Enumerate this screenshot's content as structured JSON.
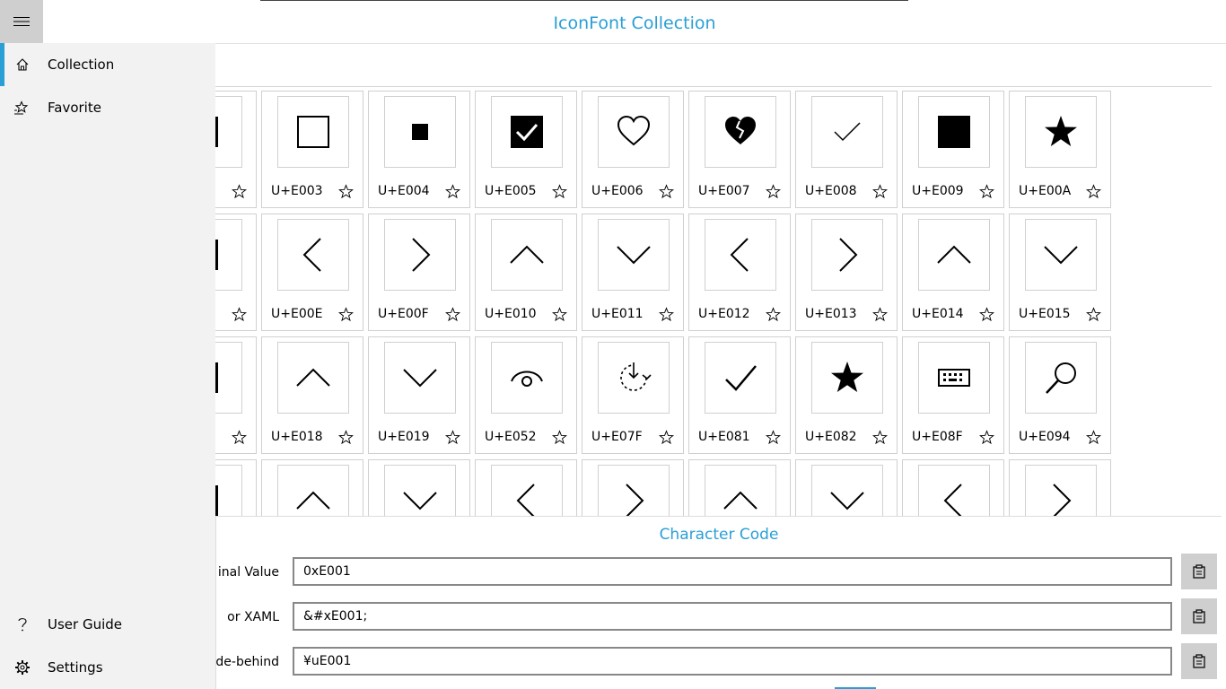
{
  "app": {
    "title": "IconFont Collection"
  },
  "nav": {
    "items": [
      {
        "label": "Collection",
        "icon": "home-icon",
        "selected": true
      },
      {
        "label": "Favorite",
        "icon": "favorite-list-icon",
        "selected": false
      }
    ],
    "footer": [
      {
        "label": "User Guide",
        "icon": "question-icon"
      },
      {
        "label": "Settings",
        "icon": "gear-icon"
      }
    ]
  },
  "grid": {
    "rows": [
      [
        {
          "code": "",
          "glyph": "partial"
        },
        {
          "code": "U+E003",
          "glyph": "square-outline"
        },
        {
          "code": "U+E004",
          "glyph": "small-square"
        },
        {
          "code": "U+E005",
          "glyph": "checkbox-checked"
        },
        {
          "code": "U+E006",
          "glyph": "heart-outline"
        },
        {
          "code": "U+E007",
          "glyph": "heart-broken"
        },
        {
          "code": "U+E008",
          "glyph": "check-small"
        },
        {
          "code": "U+E009",
          "glyph": "square-filled"
        },
        {
          "code": "U+E00A",
          "glyph": "star-filled"
        }
      ],
      [
        {
          "code": "",
          "glyph": "partial"
        },
        {
          "code": "U+E00E",
          "glyph": "chevron-left"
        },
        {
          "code": "U+E00F",
          "glyph": "chevron-right"
        },
        {
          "code": "U+E010",
          "glyph": "chevron-up"
        },
        {
          "code": "U+E011",
          "glyph": "chevron-down"
        },
        {
          "code": "U+E012",
          "glyph": "chevron-left"
        },
        {
          "code": "U+E013",
          "glyph": "chevron-right"
        },
        {
          "code": "U+E014",
          "glyph": "chevron-up"
        },
        {
          "code": "U+E015",
          "glyph": "chevron-down"
        }
      ],
      [
        {
          "code": "",
          "glyph": "partial"
        },
        {
          "code": "U+E018",
          "glyph": "chevron-up"
        },
        {
          "code": "U+E019",
          "glyph": "chevron-down"
        },
        {
          "code": "U+E052",
          "glyph": "eye"
        },
        {
          "code": "U+E07F",
          "glyph": "sync"
        },
        {
          "code": "U+E081",
          "glyph": "check-large"
        },
        {
          "code": "U+E082",
          "glyph": "star-filled"
        },
        {
          "code": "U+E08F",
          "glyph": "keyboard"
        },
        {
          "code": "U+E094",
          "glyph": "search"
        }
      ],
      [
        {
          "code": "",
          "glyph": "partial"
        },
        {
          "code": "",
          "glyph": "chevron-up"
        },
        {
          "code": "",
          "glyph": "chevron-down"
        },
        {
          "code": "",
          "glyph": "chevron-left"
        },
        {
          "code": "",
          "glyph": "chevron-right"
        },
        {
          "code": "",
          "glyph": "chevron-up"
        },
        {
          "code": "",
          "glyph": "chevron-down"
        },
        {
          "code": "",
          "glyph": "chevron-left"
        },
        {
          "code": "",
          "glyph": "chevron-right"
        }
      ]
    ]
  },
  "panel": {
    "title": "Character Code",
    "rows": [
      {
        "label": "inal Value",
        "value": "0xE001"
      },
      {
        "label": "or XAML",
        "value": "&#xE001;"
      },
      {
        "label": "ode-behind",
        "value": "¥uE001"
      }
    ]
  },
  "colors": {
    "accent": "#2a9fd6",
    "pane": "#f2f2f2"
  }
}
